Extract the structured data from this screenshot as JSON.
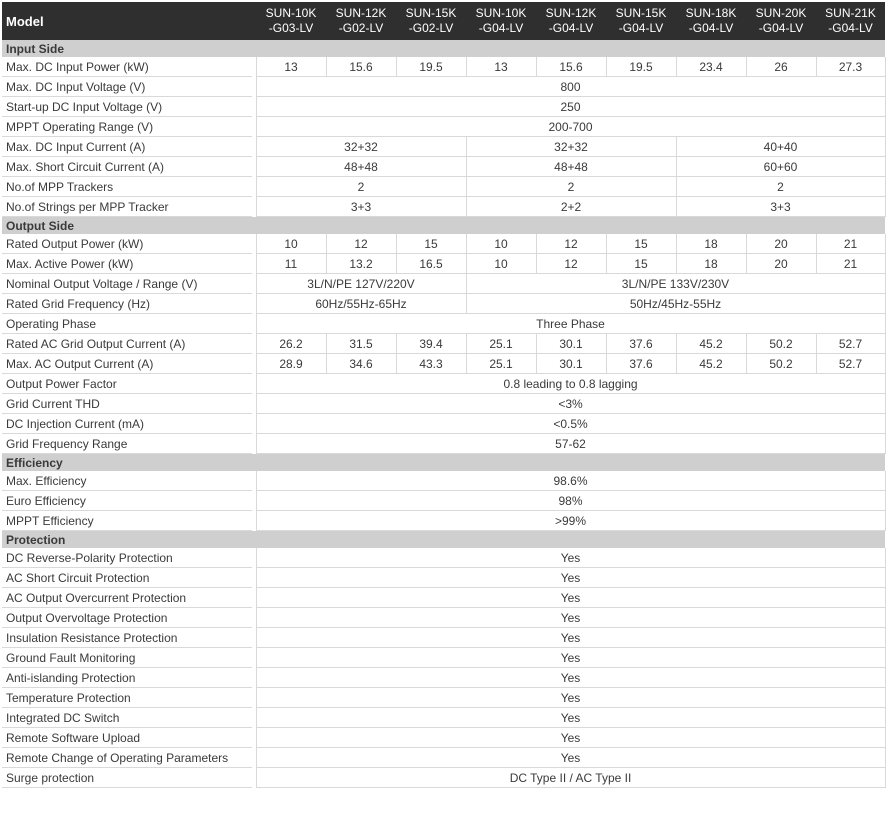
{
  "header": {
    "model_label": "Model",
    "models": [
      [
        "SUN-10K",
        "-G03-LV"
      ],
      [
        "SUN-12K",
        "-G02-LV"
      ],
      [
        "SUN-15K",
        "-G02-LV"
      ],
      [
        "SUN-10K",
        "-G04-LV"
      ],
      [
        "SUN-12K",
        "-G04-LV"
      ],
      [
        "SUN-15K",
        "-G04-LV"
      ],
      [
        "SUN-18K",
        "-G04-LV"
      ],
      [
        "SUN-20K",
        "-G04-LV"
      ],
      [
        "SUN-21K",
        "-G04-LV"
      ]
    ]
  },
  "sections": [
    {
      "title": "Input Side",
      "rows": [
        {
          "label": "Max. DC Input Power (kW)",
          "cells": [
            [
              "13",
              1
            ],
            [
              "15.6",
              1
            ],
            [
              "19.5",
              1
            ],
            [
              "13",
              1
            ],
            [
              "15.6",
              1
            ],
            [
              "19.5",
              1
            ],
            [
              "23.4",
              1
            ],
            [
              "26",
              1
            ],
            [
              "27.3",
              1
            ]
          ]
        },
        {
          "label": "Max. DC Input Voltage (V)",
          "cells": [
            [
              "800",
              9
            ]
          ]
        },
        {
          "label": "Start-up DC Input Voltage (V)",
          "cells": [
            [
              "250",
              9
            ]
          ]
        },
        {
          "label": "MPPT Operating Range (V)",
          "cells": [
            [
              "200-700",
              9
            ]
          ]
        },
        {
          "label": "Max. DC Input Current (A)",
          "cells": [
            [
              "32+32",
              3
            ],
            [
              "32+32",
              3
            ],
            [
              "40+40",
              3
            ]
          ]
        },
        {
          "label": "Max. Short Circuit Current (A)",
          "cells": [
            [
              "48+48",
              3
            ],
            [
              "48+48",
              3
            ],
            [
              "60+60",
              3
            ]
          ]
        },
        {
          "label": "No.of MPP Trackers",
          "cells": [
            [
              "2",
              3
            ],
            [
              "2",
              3
            ],
            [
              "2",
              3
            ]
          ]
        },
        {
          "label": "No.of Strings per MPP Tracker",
          "cells": [
            [
              "3+3",
              3
            ],
            [
              "2+2",
              3
            ],
            [
              "3+3",
              3
            ]
          ]
        }
      ]
    },
    {
      "title": "Output Side",
      "rows": [
        {
          "label": "Rated Output Power (kW)",
          "cells": [
            [
              "10",
              1
            ],
            [
              "12",
              1
            ],
            [
              "15",
              1
            ],
            [
              "10",
              1
            ],
            [
              "12",
              1
            ],
            [
              "15",
              1
            ],
            [
              "18",
              1
            ],
            [
              "20",
              1
            ],
            [
              "21",
              1
            ]
          ]
        },
        {
          "label": "Max. Active Power (kW)",
          "cells": [
            [
              "11",
              1
            ],
            [
              "13.2",
              1
            ],
            [
              "16.5",
              1
            ],
            [
              "10",
              1
            ],
            [
              "12",
              1
            ],
            [
              "15",
              1
            ],
            [
              "18",
              1
            ],
            [
              "20",
              1
            ],
            [
              "21",
              1
            ]
          ]
        },
        {
          "label": "Nominal Output Voltage / Range (V)",
          "cells": [
            [
              "3L/N/PE 127V/220V",
              3
            ],
            [
              "3L/N/PE 133V/230V",
              6
            ]
          ]
        },
        {
          "label": "Rated Grid Frequency (Hz)",
          "cells": [
            [
              "60Hz/55Hz-65Hz",
              3
            ],
            [
              "50Hz/45Hz-55Hz",
              6
            ]
          ]
        },
        {
          "label": "Operating Phase",
          "cells": [
            [
              "Three Phase",
              9
            ]
          ]
        },
        {
          "label": "Rated AC Grid Output Current (A)",
          "cells": [
            [
              "26.2",
              1
            ],
            [
              "31.5",
              1
            ],
            [
              "39.4",
              1
            ],
            [
              "25.1",
              1
            ],
            [
              "30.1",
              1
            ],
            [
              "37.6",
              1
            ],
            [
              "45.2",
              1
            ],
            [
              "50.2",
              1
            ],
            [
              "52.7",
              1
            ]
          ]
        },
        {
          "label": "Max. AC Output Current (A)",
          "cells": [
            [
              "28.9",
              1
            ],
            [
              "34.6",
              1
            ],
            [
              "43.3",
              1
            ],
            [
              "25.1",
              1
            ],
            [
              "30.1",
              1
            ],
            [
              "37.6",
              1
            ],
            [
              "45.2",
              1
            ],
            [
              "50.2",
              1
            ],
            [
              "52.7",
              1
            ]
          ]
        },
        {
          "label": "Output Power Factor",
          "cells": [
            [
              "0.8 leading to 0.8 lagging",
              9
            ]
          ]
        },
        {
          "label": "Grid Current THD",
          "cells": [
            [
              "<3%",
              9
            ]
          ]
        },
        {
          "label": "DC Injection Current (mA)",
          "cells": [
            [
              "<0.5%",
              9
            ]
          ]
        },
        {
          "label": "Grid Frequency Range",
          "cells": [
            [
              "57-62",
              9
            ]
          ]
        }
      ]
    },
    {
      "title": "Efficiency",
      "rows": [
        {
          "label": "Max. Efficiency",
          "cells": [
            [
              "98.6%",
              9
            ]
          ]
        },
        {
          "label": "Euro Efficiency",
          "cells": [
            [
              "98%",
              9
            ]
          ]
        },
        {
          "label": "MPPT Efficiency",
          "cells": [
            [
              ">99%",
              9
            ]
          ]
        }
      ]
    },
    {
      "title": "Protection",
      "rows": [
        {
          "label": "DC Reverse-Polarity Protection",
          "cells": [
            [
              "Yes",
              9
            ]
          ]
        },
        {
          "label": "AC Short Circuit Protection",
          "cells": [
            [
              "Yes",
              9
            ]
          ]
        },
        {
          "label": "AC Output Overcurrent Protection",
          "cells": [
            [
              "Yes",
              9
            ]
          ]
        },
        {
          "label": "Output Overvoltage Protection",
          "cells": [
            [
              "Yes",
              9
            ]
          ]
        },
        {
          "label": "Insulation Resistance Protection",
          "cells": [
            [
              "Yes",
              9
            ]
          ]
        },
        {
          "label": "Ground Fault Monitoring",
          "cells": [
            [
              "Yes",
              9
            ]
          ]
        },
        {
          "label": "Anti-islanding Protection",
          "cells": [
            [
              "Yes",
              9
            ]
          ]
        },
        {
          "label": "Temperature Protection",
          "cells": [
            [
              "Yes",
              9
            ]
          ]
        },
        {
          "label": "Integrated DC Switch",
          "cells": [
            [
              "Yes",
              9
            ]
          ]
        },
        {
          "label": "Remote Software Upload",
          "cells": [
            [
              "Yes",
              9
            ]
          ]
        },
        {
          "label": "Remote Change of Operating Parameters",
          "cells": [
            [
              "Yes",
              9
            ]
          ]
        },
        {
          "label": "Surge protection",
          "cells": [
            [
              "DC Type II / AC Type II",
              9
            ]
          ]
        }
      ]
    }
  ]
}
